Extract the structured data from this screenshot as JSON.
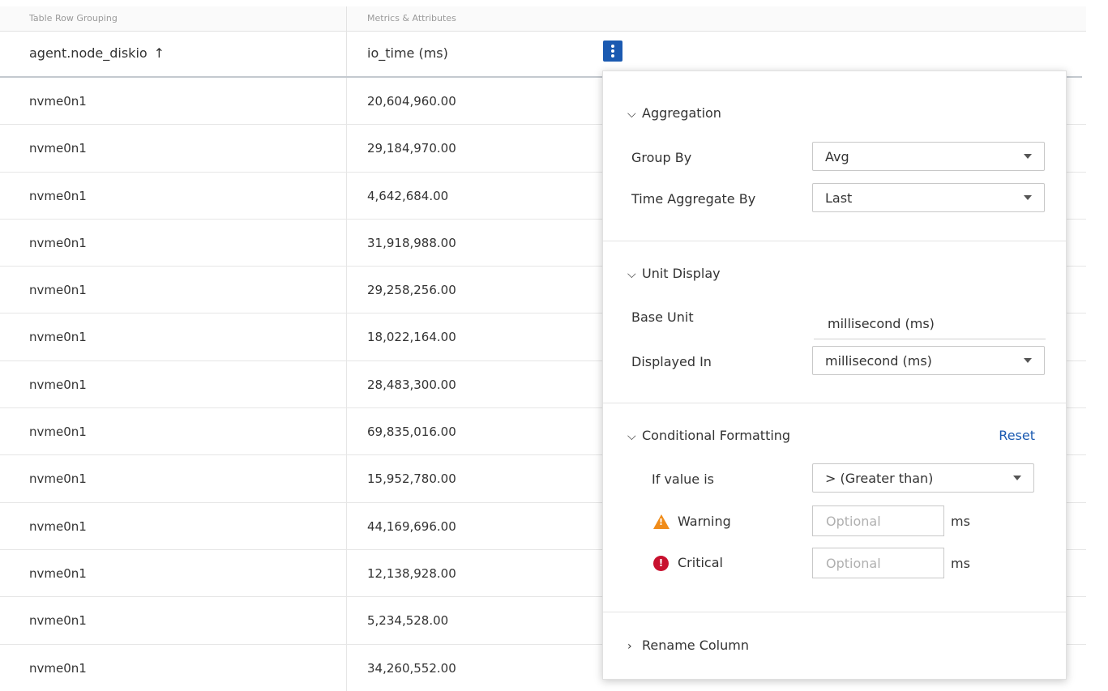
{
  "header_groups": {
    "row_grouping": "Table Row Grouping",
    "metrics": "Metrics & Attributes"
  },
  "columns": {
    "col1": "agent.node_diskio",
    "col2": "io_time (ms)"
  },
  "sort_icon": "arrow-up-icon",
  "rows": [
    {
      "node": "nvme0n1",
      "io_time": "20,604,960.00"
    },
    {
      "node": "nvme0n1",
      "io_time": "29,184,970.00"
    },
    {
      "node": "nvme0n1",
      "io_time": "4,642,684.00"
    },
    {
      "node": "nvme0n1",
      "io_time": "31,918,988.00"
    },
    {
      "node": "nvme0n1",
      "io_time": "29,258,256.00"
    },
    {
      "node": "nvme0n1",
      "io_time": "18,022,164.00"
    },
    {
      "node": "nvme0n1",
      "io_time": "28,483,300.00"
    },
    {
      "node": "nvme0n1",
      "io_time": "69,835,016.00"
    },
    {
      "node": "nvme0n1",
      "io_time": "15,952,780.00"
    },
    {
      "node": "nvme0n1",
      "io_time": "44,169,696.00"
    },
    {
      "node": "nvme0n1",
      "io_time": "12,138,928.00"
    },
    {
      "node": "nvme0n1",
      "io_time": "5,234,528.00"
    },
    {
      "node": "nvme0n1",
      "io_time": "34,260,552.00"
    }
  ],
  "panel": {
    "aggregation": {
      "title": "Aggregation",
      "group_by_label": "Group By",
      "group_by_value": "Avg",
      "time_agg_label": "Time Aggregate By",
      "time_agg_value": "Last"
    },
    "unit_display": {
      "title": "Unit Display",
      "base_unit_label": "Base Unit",
      "base_unit_value": "millisecond (ms)",
      "displayed_in_label": "Displayed In",
      "displayed_in_value": "millisecond (ms)"
    },
    "conditional": {
      "title": "Conditional Formatting",
      "reset": "Reset",
      "if_value_label": "If value is",
      "if_value_value": "> (Greater than)",
      "warning_label": "Warning",
      "warning_placeholder": "Optional",
      "warning_unit": "ms",
      "critical_label": "Critical",
      "critical_placeholder": "Optional",
      "critical_unit": "ms"
    },
    "rename": {
      "title": "Rename Column"
    }
  },
  "colors": {
    "accent": "#1b5ab1",
    "warning": "#f08c1a",
    "critical": "#c8102e"
  }
}
